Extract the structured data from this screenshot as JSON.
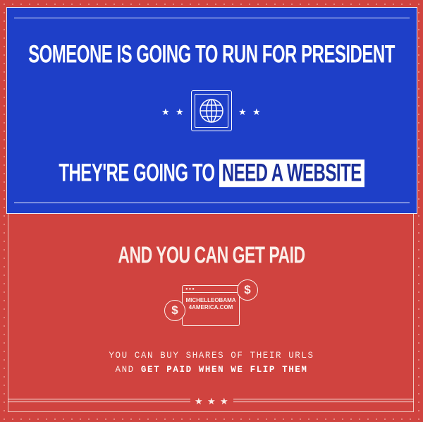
{
  "panel_top": {
    "headline": "SOMEONE IS GOING TO RUN FOR PRESIDENT",
    "line2_prefix": "THEY'RE GOING TO",
    "line2_highlight": "NEED A WEBSITE",
    "icon": "globe-icon"
  },
  "panel_bottom": {
    "headline": "AND YOU CAN GET PAID",
    "url_line1": "MICHELLEOBAMA",
    "url_line2": "4AMERICA.COM",
    "dollar": "$",
    "sub_line1": "YOU CAN BUY SHARES OF THEIR URLS",
    "sub_line2_prefix": "AND ",
    "sub_line2_bold": "GET PAID WHEN WE FLIP THEM"
  },
  "star_glyph": "★",
  "colors": {
    "red": "#d0433f",
    "blue": "#1e3fc8",
    "cream": "#fbeee9",
    "highlight_text": "#1b2f9a"
  }
}
